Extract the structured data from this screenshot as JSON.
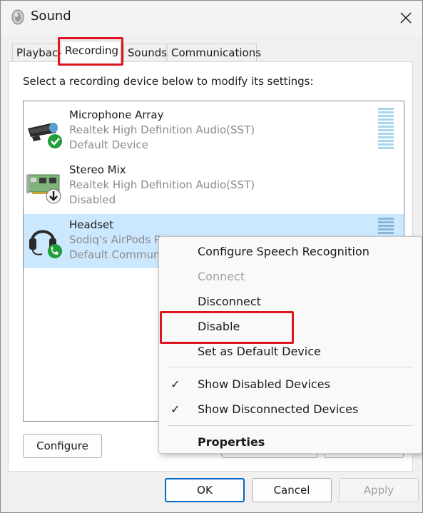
{
  "window": {
    "title": "Sound",
    "colors": {
      "accent": "#0067c0",
      "selection": "#cce8ff",
      "highlight": "#e0141e"
    }
  },
  "tabs": [
    {
      "label": "Playback",
      "active": false
    },
    {
      "label": "Recording",
      "active": true
    },
    {
      "label": "Sounds",
      "active": false
    },
    {
      "label": "Communications",
      "active": false
    }
  ],
  "panel": {
    "instruction": "Select a recording device below to modify its settings:"
  },
  "devices": [
    {
      "name": "Microphone Array",
      "driver": "Realtek High Definition Audio(SST)",
      "status": "Default Device",
      "icon": "microphone-icon",
      "badge": "green-check-badge"
    },
    {
      "name": "Stereo Mix",
      "driver": "Realtek High Definition Audio(SST)",
      "status": "Disabled",
      "icon": "sound-card-icon",
      "badge": "down-arrow-badge"
    },
    {
      "name": "Headset",
      "driver": "Sodiq's AirPods Pr",
      "status": "Default Communi",
      "icon": "headset-icon",
      "badge": "phone-badge",
      "selected": true
    }
  ],
  "buttons": {
    "configure": "Configure",
    "ok": "OK",
    "cancel": "Cancel",
    "apply": "Apply"
  },
  "context_menu": {
    "items": [
      {
        "label": "Configure Speech Recognition"
      },
      {
        "label": "Connect",
        "disabled": true
      },
      {
        "label": "Disconnect"
      },
      {
        "label": "Disable"
      },
      {
        "label": "Set as Default Device"
      },
      {
        "label": "Show Disabled Devices",
        "checked": true
      },
      {
        "label": "Show Disconnected Devices",
        "checked": true
      },
      {
        "label": "Properties",
        "bold": true
      }
    ],
    "check_glyph": "✓"
  }
}
